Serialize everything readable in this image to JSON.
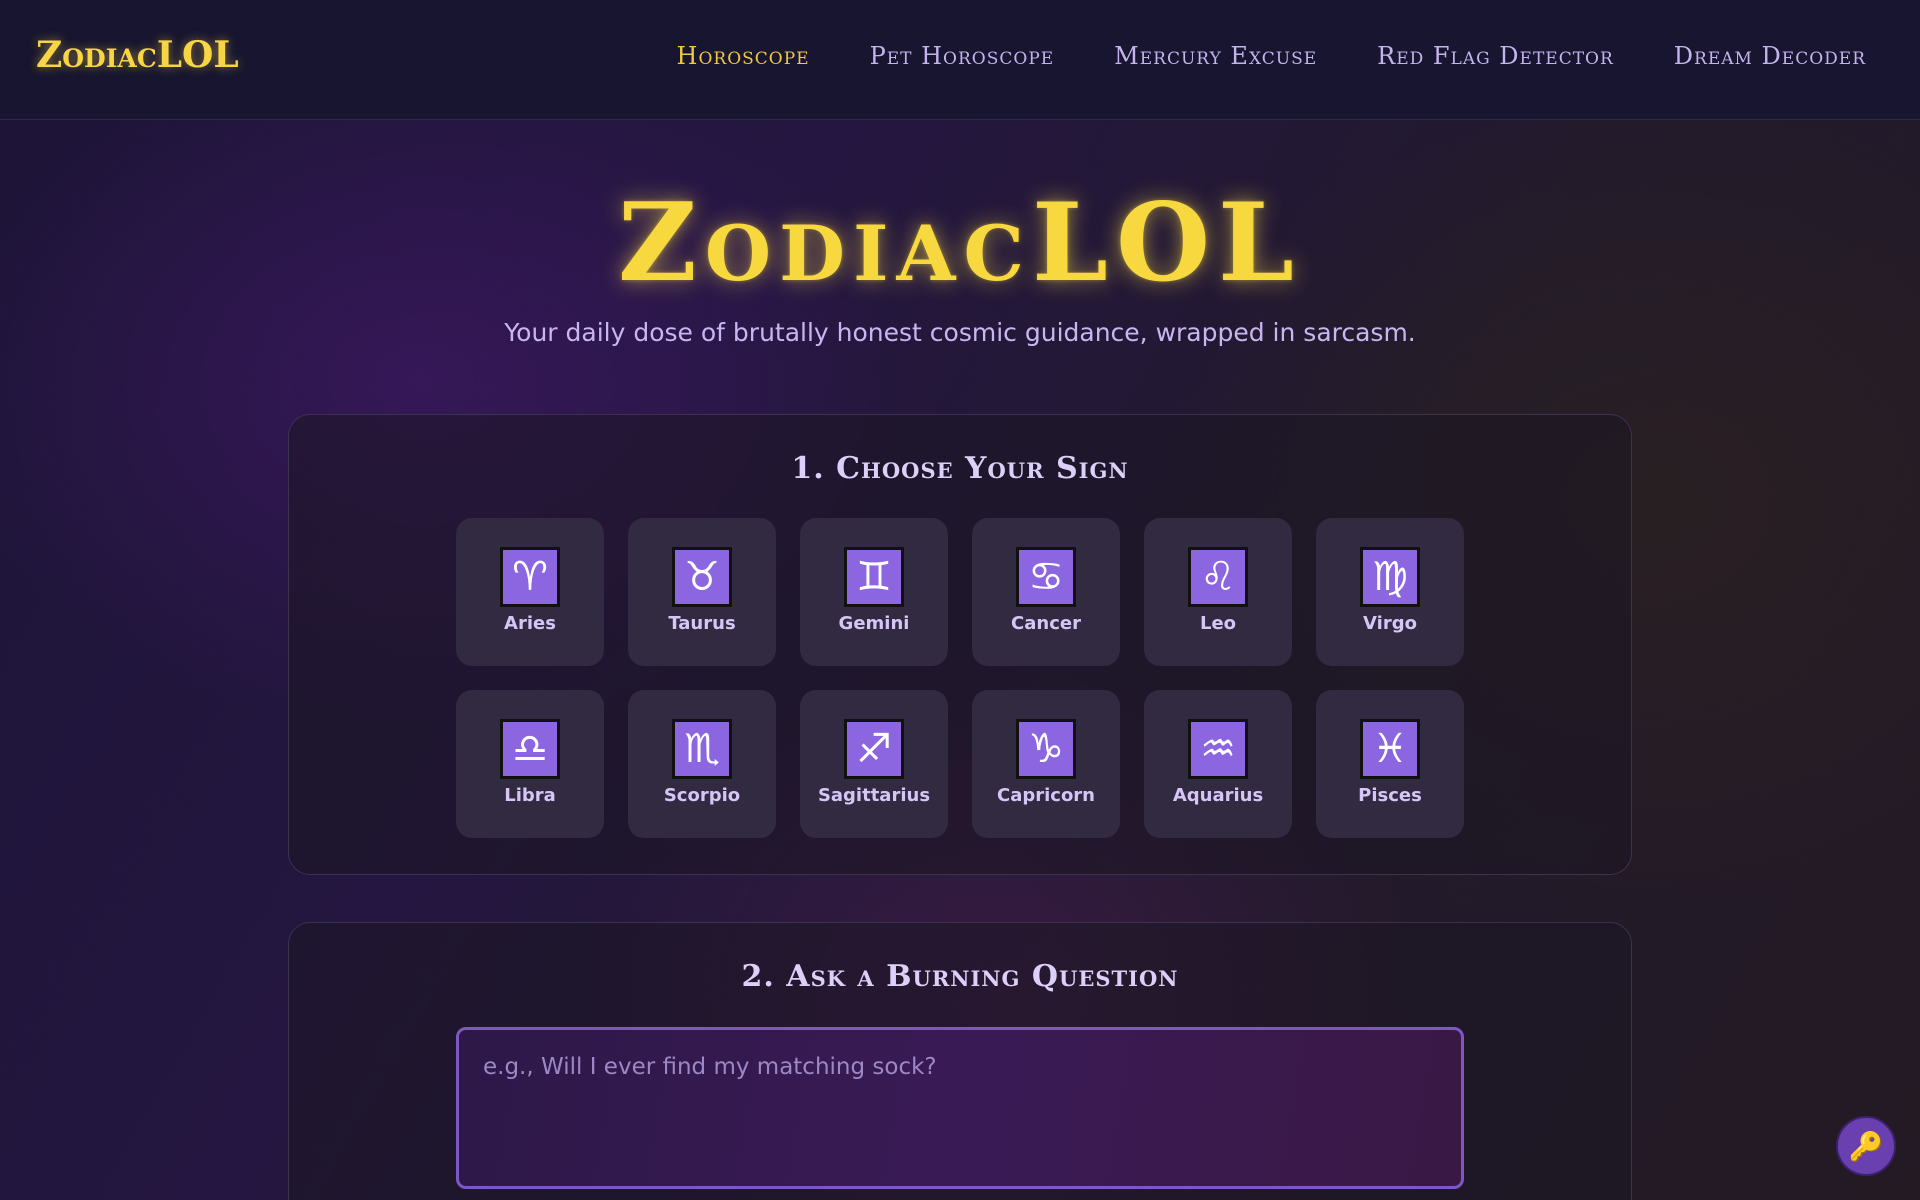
{
  "header": {
    "brand": "ZodiacLOL",
    "nav": [
      {
        "label": "Horoscope",
        "active": true
      },
      {
        "label": "Pet Horoscope",
        "active": false
      },
      {
        "label": "Mercury Excuse",
        "active": false
      },
      {
        "label": "Red Flag Detector",
        "active": false
      },
      {
        "label": "Dream Decoder",
        "active": false
      }
    ]
  },
  "hero": {
    "title": "ZodiacLOL",
    "subtitle": "Your daily dose of brutally honest cosmic guidance, wrapped in sarcasm."
  },
  "step1": {
    "title": "1. Choose Your Sign",
    "signs": [
      {
        "name": "Aries",
        "symbol": "♈"
      },
      {
        "name": "Taurus",
        "symbol": "♉"
      },
      {
        "name": "Gemini",
        "symbol": "♊"
      },
      {
        "name": "Cancer",
        "symbol": "♋"
      },
      {
        "name": "Leo",
        "symbol": "♌"
      },
      {
        "name": "Virgo",
        "symbol": "♍"
      },
      {
        "name": "Libra",
        "symbol": "♎"
      },
      {
        "name": "Scorpio",
        "symbol": "♏"
      },
      {
        "name": "Sagittarius",
        "symbol": "♐"
      },
      {
        "name": "Capricorn",
        "symbol": "♑"
      },
      {
        "name": "Aquarius",
        "symbol": "♒"
      },
      {
        "name": "Pisces",
        "symbol": "♓"
      }
    ]
  },
  "step2": {
    "title": "2. Ask a Burning Question",
    "placeholder": "e.g., Will I ever find my matching sock?",
    "value": ""
  },
  "fab": {
    "icon": "key-icon",
    "glyph": "🔑"
  },
  "colors": {
    "accent_gold": "#f7d544",
    "accent_purple": "#8b66e0",
    "nav_text": "#c4b4ec"
  }
}
